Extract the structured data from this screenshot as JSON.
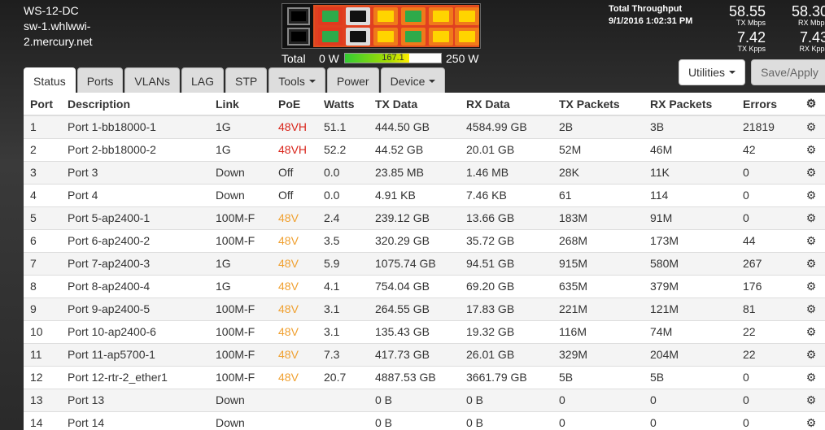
{
  "device": {
    "model": "WS-12-DC",
    "hostname_line1": "sw-1.whlwwi-",
    "hostname_line2": "2.mercury.net"
  },
  "power": {
    "total_label": "Total",
    "min_label": "0 W",
    "current_value": "167.1",
    "current_fraction": 0.668,
    "max_label": "250 W"
  },
  "throughput": {
    "title": "Total Throughput",
    "timestamp": "9/1/2016 1:02:31 PM",
    "tx_mbps": "58.55",
    "tx_mbps_unit": "TX Mbps",
    "rx_mbps": "58.30",
    "rx_mbps_unit": "RX Mbps",
    "tx_kpps": "7.42",
    "tx_kpps_unit": "TX Kpps",
    "rx_kpps": "7.43",
    "rx_kpps_unit": "RX Kpps"
  },
  "colors": {
    "port_green": "#2eaa4a",
    "port_yellow": "#ffd400",
    "port_black": "#111111",
    "port_red_border": "#e03a1e",
    "port_orange_border": "#f07a1a",
    "poe_red": "#d9261c",
    "poe_orange": "#f0a030"
  },
  "buttons": {
    "utilities": "Utilities",
    "save_apply": "Save/Apply"
  },
  "tabs": [
    {
      "label": "Status"
    },
    {
      "label": "Ports"
    },
    {
      "label": "VLANs"
    },
    {
      "label": "LAG"
    },
    {
      "label": "STP"
    },
    {
      "label": "Tools"
    },
    {
      "label": "Power"
    },
    {
      "label": "Device"
    }
  ],
  "table": {
    "headers": {
      "port": "Port",
      "description": "Description",
      "link": "Link",
      "poe": "PoE",
      "watts": "Watts",
      "tx_data": "TX Data",
      "rx_data": "RX Data",
      "tx_packets": "TX Packets",
      "rx_packets": "RX Packets",
      "errors": "Errors",
      "settings_icon": "gear-icon"
    },
    "rows": [
      {
        "port": "1",
        "description": "Port 1-bb18000-1",
        "link": "1G",
        "poe": "48VH",
        "poe_color": "red",
        "watts": "51.1",
        "tx_data": "444.50 GB",
        "rx_data": "4584.99 GB",
        "tx_packets": "2B",
        "rx_packets": "3B",
        "errors": "21819"
      },
      {
        "port": "2",
        "description": "Port 2-bb18000-2",
        "link": "1G",
        "poe": "48VH",
        "poe_color": "red",
        "watts": "52.2",
        "tx_data": "44.52 GB",
        "rx_data": "20.01 GB",
        "tx_packets": "52M",
        "rx_packets": "46M",
        "errors": "42"
      },
      {
        "port": "3",
        "description": "Port 3",
        "link": "Down",
        "poe": "Off",
        "poe_color": "none",
        "watts": "0.0",
        "tx_data": "23.85 MB",
        "rx_data": "1.46 MB",
        "tx_packets": "28K",
        "rx_packets": "11K",
        "errors": "0"
      },
      {
        "port": "4",
        "description": "Port 4",
        "link": "Down",
        "poe": "Off",
        "poe_color": "none",
        "watts": "0.0",
        "tx_data": "4.91 KB",
        "rx_data": "7.46 KB",
        "tx_packets": "61",
        "rx_packets": "114",
        "errors": "0"
      },
      {
        "port": "5",
        "description": "Port 5-ap2400-1",
        "link": "100M-F",
        "poe": "48V",
        "poe_color": "orange",
        "watts": "2.4",
        "tx_data": "239.12 GB",
        "rx_data": "13.66 GB",
        "tx_packets": "183M",
        "rx_packets": "91M",
        "errors": "0"
      },
      {
        "port": "6",
        "description": "Port 6-ap2400-2",
        "link": "100M-F",
        "poe": "48V",
        "poe_color": "orange",
        "watts": "3.5",
        "tx_data": "320.29 GB",
        "rx_data": "35.72 GB",
        "tx_packets": "268M",
        "rx_packets": "173M",
        "errors": "44"
      },
      {
        "port": "7",
        "description": "Port 7-ap2400-3",
        "link": "1G",
        "poe": "48V",
        "poe_color": "orange",
        "watts": "5.9",
        "tx_data": "1075.74 GB",
        "rx_data": "94.51 GB",
        "tx_packets": "915M",
        "rx_packets": "580M",
        "errors": "267"
      },
      {
        "port": "8",
        "description": "Port 8-ap2400-4",
        "link": "1G",
        "poe": "48V",
        "poe_color": "orange",
        "watts": "4.1",
        "tx_data": "754.04 GB",
        "rx_data": "69.20 GB",
        "tx_packets": "635M",
        "rx_packets": "379M",
        "errors": "176"
      },
      {
        "port": "9",
        "description": "Port 9-ap2400-5",
        "link": "100M-F",
        "poe": "48V",
        "poe_color": "orange",
        "watts": "3.1",
        "tx_data": "264.55 GB",
        "rx_data": "17.83 GB",
        "tx_packets": "221M",
        "rx_packets": "121M",
        "errors": "81"
      },
      {
        "port": "10",
        "description": "Port 10-ap2400-6",
        "link": "100M-F",
        "poe": "48V",
        "poe_color": "orange",
        "watts": "3.1",
        "tx_data": "135.43 GB",
        "rx_data": "19.32 GB",
        "tx_packets": "116M",
        "rx_packets": "74M",
        "errors": "22"
      },
      {
        "port": "11",
        "description": "Port 11-ap5700-1",
        "link": "100M-F",
        "poe": "48V",
        "poe_color": "orange",
        "watts": "7.3",
        "tx_data": "417.73 GB",
        "rx_data": "26.01 GB",
        "tx_packets": "329M",
        "rx_packets": "204M",
        "errors": "22"
      },
      {
        "port": "12",
        "description": "Port 12-rtr-2_ether1",
        "link": "100M-F",
        "poe": "48V",
        "poe_color": "orange",
        "watts": "20.7",
        "tx_data": "4887.53 GB",
        "rx_data": "3661.79 GB",
        "tx_packets": "5B",
        "rx_packets": "5B",
        "errors": "0"
      },
      {
        "port": "13",
        "description": "Port 13",
        "link": "Down",
        "poe": "",
        "poe_color": "none",
        "watts": "",
        "tx_data": "0 B",
        "rx_data": "0 B",
        "tx_packets": "0",
        "rx_packets": "0",
        "errors": "0"
      },
      {
        "port": "14",
        "description": "Port 14",
        "link": "Down",
        "poe": "",
        "poe_color": "none",
        "watts": "",
        "tx_data": "0 B",
        "rx_data": "0 B",
        "tx_packets": "0",
        "rx_packets": "0",
        "errors": "0"
      }
    ]
  }
}
